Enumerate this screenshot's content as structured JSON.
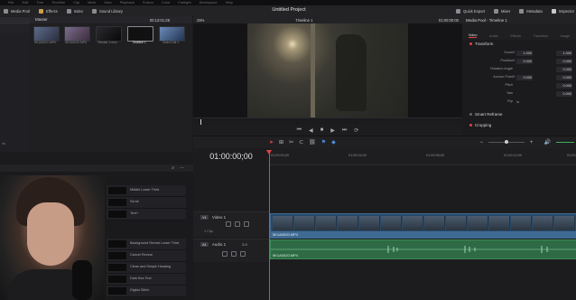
{
  "menubar": {
    "items": [
      "File",
      "Edit",
      "Trim",
      "Timeline",
      "Clip",
      "Mark",
      "View",
      "Playback",
      "Fusion",
      "Color",
      "Fairlight",
      "Workspace",
      "Help"
    ]
  },
  "toolbar": {
    "left": [
      {
        "label": "Media Pool",
        "icon": "media-pool-icon"
      },
      {
        "label": "Effects",
        "icon": "effects-icon"
      },
      {
        "label": "Index",
        "icon": "index-icon"
      },
      {
        "label": "Sound Library",
        "icon": "sound-library-icon"
      }
    ],
    "project_title": "Untitled Project",
    "right": [
      {
        "label": "Quick Export"
      },
      {
        "label": "Mixer"
      },
      {
        "label": "Metadata"
      },
      {
        "label": "Inspector"
      }
    ]
  },
  "media_pool": {
    "bin_label": "Master",
    "clips": [
      "5K1A0021.MP4",
      "5K1A0020.MP4",
      "Render 1.mov",
      "Timeline 1",
      "Video Edit 1"
    ]
  },
  "viewer": {
    "zoom": "26%",
    "source_tc": "00:13:01:28",
    "timeline_name": "Timeline 1",
    "record_tc": "01:00:00:00"
  },
  "inspector": {
    "header": "Media Pool - Timeline 1",
    "tabs": [
      "Video",
      "Audio",
      "Effects",
      "Transition",
      "Image"
    ],
    "section_transform": "Transform",
    "props": [
      {
        "name": "Zoom",
        "x": "1.000",
        "y": "1.000"
      },
      {
        "name": "Position",
        "x": "0.000",
        "y": "0.000"
      },
      {
        "name": "Rotation Angle",
        "x": "0.000"
      },
      {
        "name": "Anchor Point",
        "x": "0.000",
        "y": "0.000"
      },
      {
        "name": "Pitch",
        "x": "0.000"
      },
      {
        "name": "Yaw",
        "x": "0.000"
      },
      {
        "name": "Flip",
        "x": ""
      }
    ],
    "section_smart": "Smart Reframe",
    "section_crop": "Cropping"
  },
  "timeline": {
    "timecode": "01:00:00;00",
    "ruler": [
      "01:00:00;00",
      "01:00:04;00",
      "01:00:08;00",
      "01:00:12;00",
      "01:00:16;00"
    ],
    "tracks": {
      "video": {
        "badge": "V1",
        "name": "Video 1",
        "clips_label": "1 Clip",
        "clip": "5K1A0020.MP4"
      },
      "audio": {
        "badge": "A1",
        "name": "Audio 1",
        "level": "2.0",
        "clip": "5K1A0020.MP4"
      }
    }
  },
  "effects": {
    "items": [
      "Middle Lower Third",
      "Scroll",
      "Text+",
      "Background Reveal Lower Third",
      "Cancel Reveal",
      "Clean and Simple Heading",
      "Dark Box Text",
      "Digital Glitch"
    ]
  },
  "colors": {
    "accent_red": "#e04343",
    "video_clip": "#3f6a92",
    "audio_clip": "#2e6b45"
  }
}
